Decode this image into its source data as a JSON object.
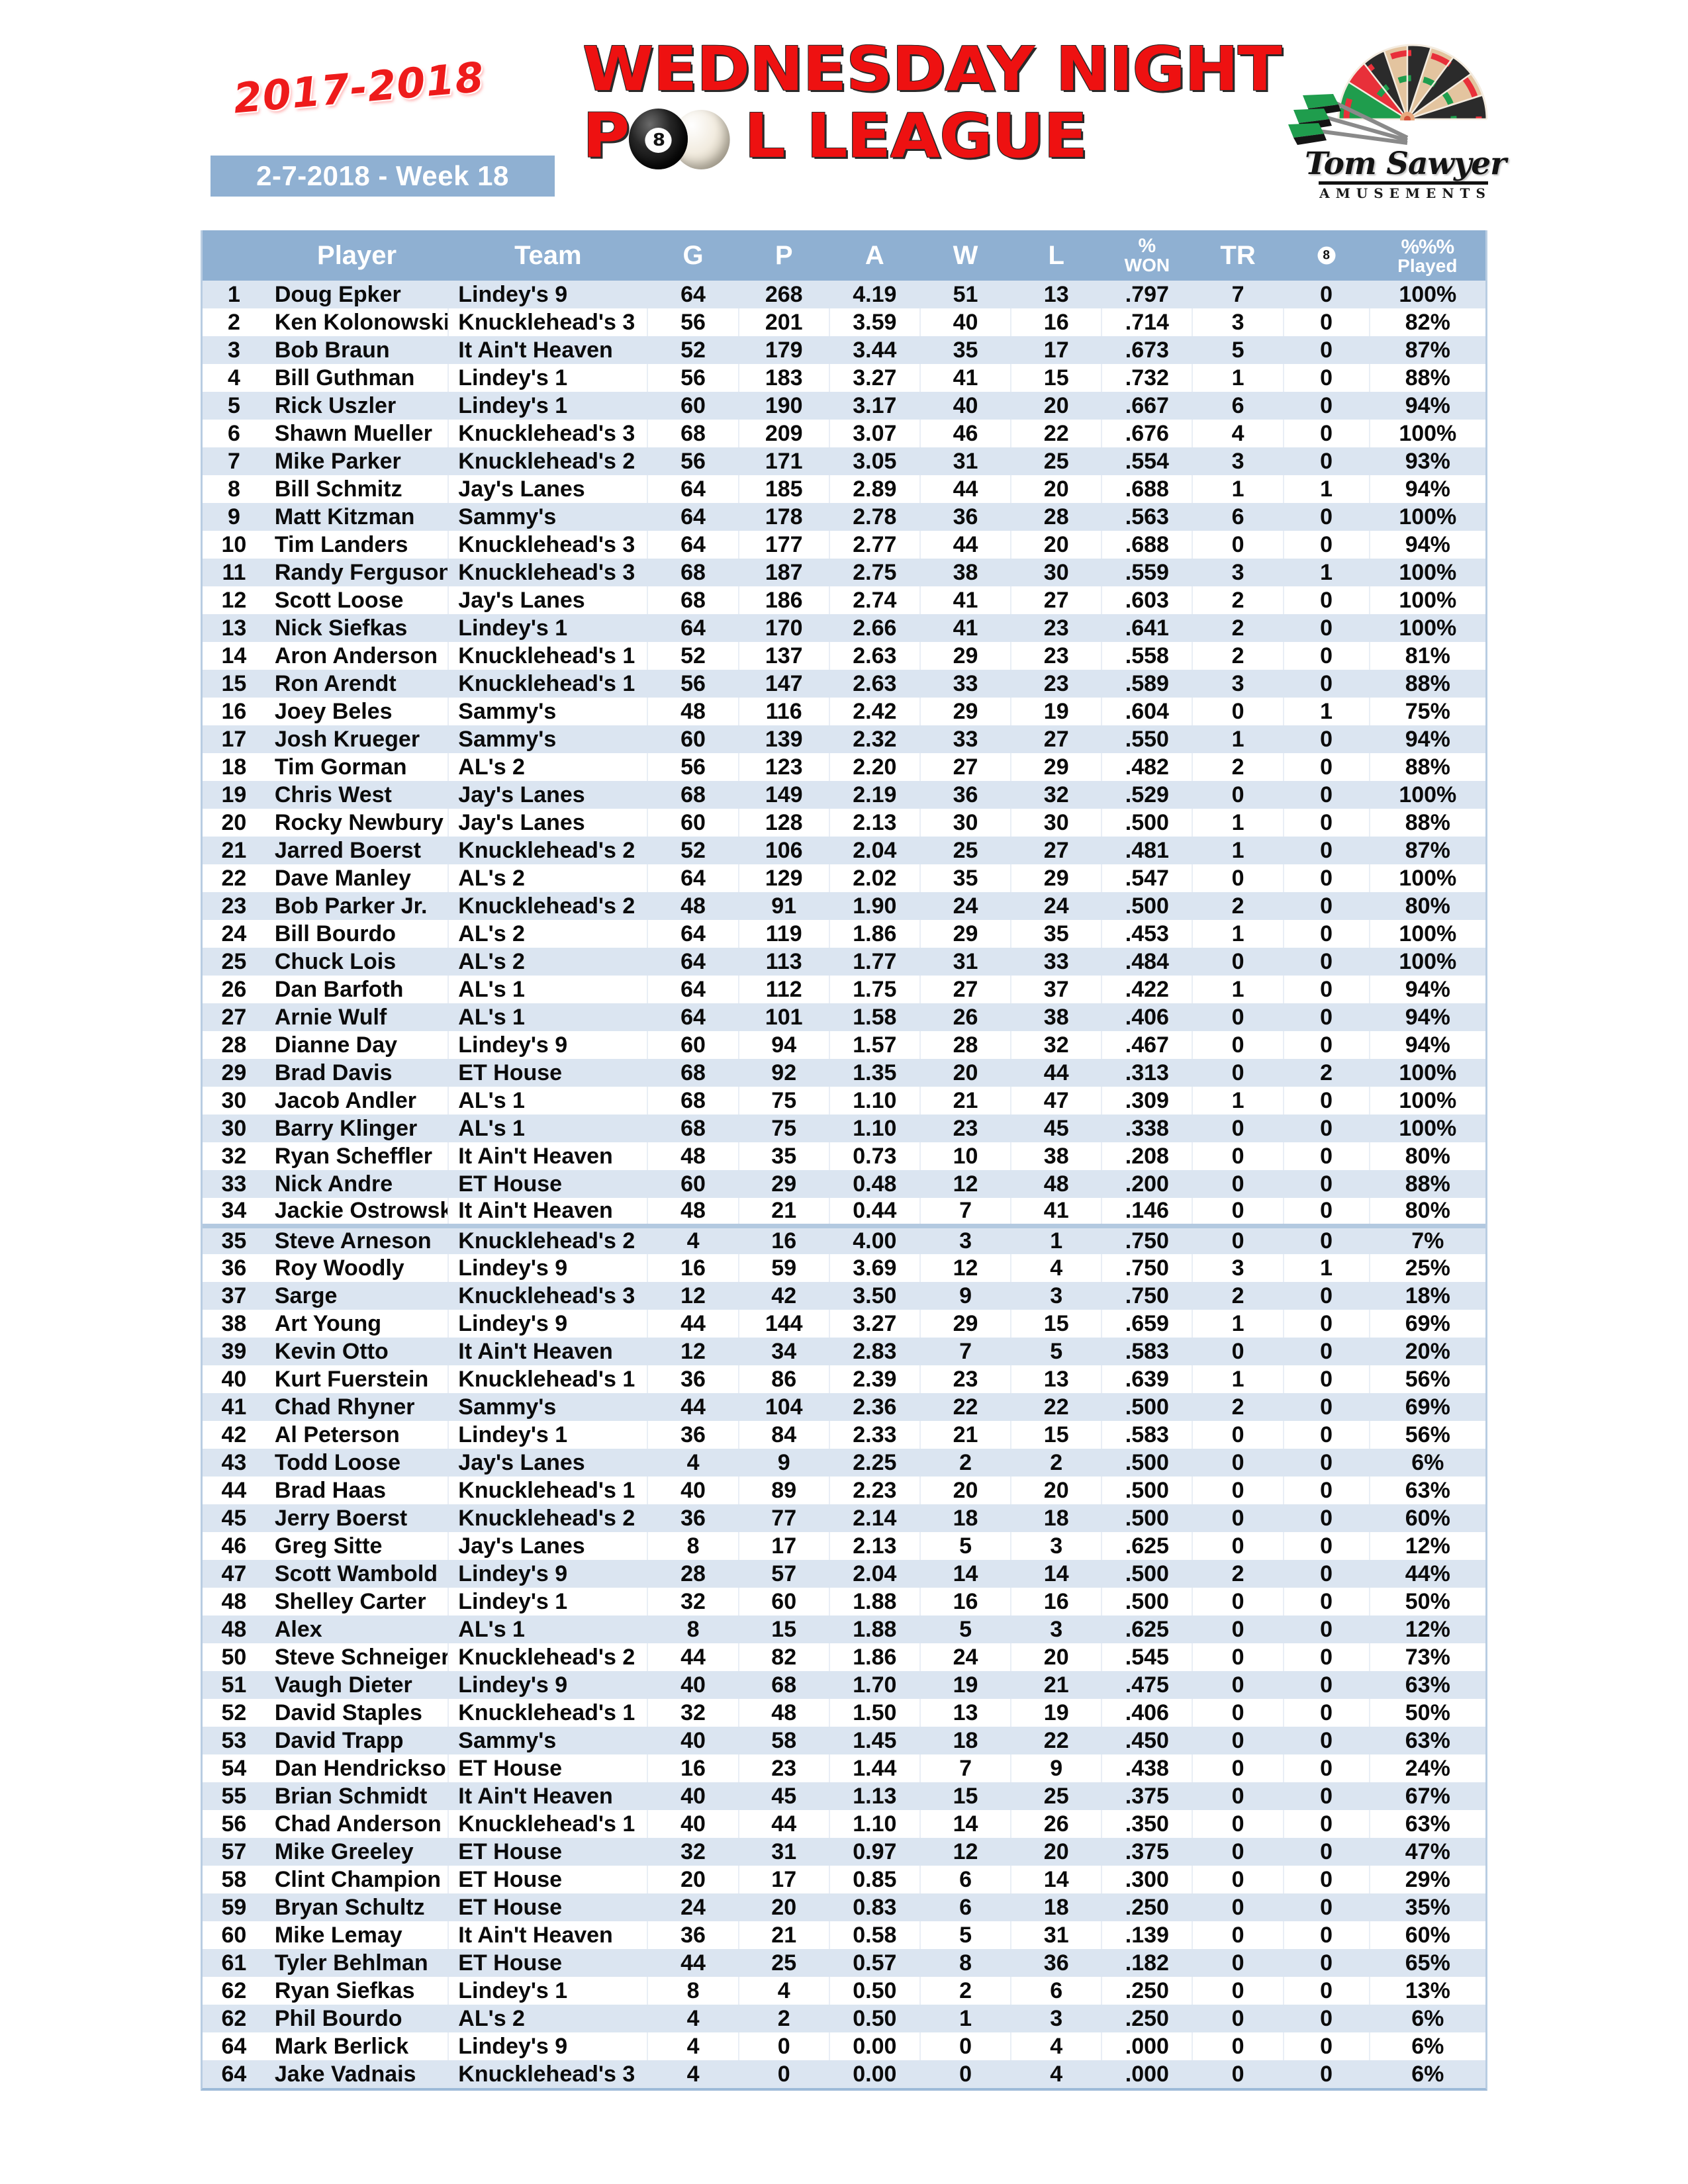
{
  "header": {
    "season": "2017-2018",
    "week_banner": "2-7-2018 - Week 18",
    "title_line1": "WEDNESDAY NIGHT",
    "title_p": "P",
    "title_l_league": "L LEAGUE",
    "logo_name": "Tom Sawyer",
    "logo_sub": "AMUSEMENTS",
    "eight_ball_label": "8"
  },
  "table": {
    "columns": {
      "rank": "",
      "player": "Player",
      "team": "Team",
      "g": "G",
      "p": "P",
      "a": "A",
      "w": "W",
      "l": "L",
      "pct_top": "%",
      "pct_bottom": "WON",
      "tr": "TR",
      "eight": "8",
      "played_top": "%%%",
      "played_bottom": "Played"
    },
    "rows": [
      {
        "rank": "1",
        "player": "Doug Epker",
        "team": "Lindey's 9",
        "g": "64",
        "p": "268",
        "a": "4.19",
        "w": "51",
        "l": "13",
        "pct": ".797",
        "tr": "7",
        "eight": "0",
        "played": "100%"
      },
      {
        "rank": "2",
        "player": "Ken Kolonowski",
        "team": "Knucklehead's 3",
        "g": "56",
        "p": "201",
        "a": "3.59",
        "w": "40",
        "l": "16",
        "pct": ".714",
        "tr": "3",
        "eight": "0",
        "played": "82%"
      },
      {
        "rank": "3",
        "player": "Bob Braun",
        "team": "It Ain't Heaven",
        "g": "52",
        "p": "179",
        "a": "3.44",
        "w": "35",
        "l": "17",
        "pct": ".673",
        "tr": "5",
        "eight": "0",
        "played": "87%"
      },
      {
        "rank": "4",
        "player": "Bill Guthman",
        "team": "Lindey's 1",
        "g": "56",
        "p": "183",
        "a": "3.27",
        "w": "41",
        "l": "15",
        "pct": ".732",
        "tr": "1",
        "eight": "0",
        "played": "88%"
      },
      {
        "rank": "5",
        "player": "Rick Uszler",
        "team": "Lindey's 1",
        "g": "60",
        "p": "190",
        "a": "3.17",
        "w": "40",
        "l": "20",
        "pct": ".667",
        "tr": "6",
        "eight": "0",
        "played": "94%"
      },
      {
        "rank": "6",
        "player": "Shawn Mueller",
        "team": "Knucklehead's 3",
        "g": "68",
        "p": "209",
        "a": "3.07",
        "w": "46",
        "l": "22",
        "pct": ".676",
        "tr": "4",
        "eight": "0",
        "played": "100%"
      },
      {
        "rank": "7",
        "player": "Mike Parker",
        "team": "Knucklehead's 2",
        "g": "56",
        "p": "171",
        "a": "3.05",
        "w": "31",
        "l": "25",
        "pct": ".554",
        "tr": "3",
        "eight": "0",
        "played": "93%"
      },
      {
        "rank": "8",
        "player": "Bill Schmitz",
        "team": "Jay's Lanes",
        "g": "64",
        "p": "185",
        "a": "2.89",
        "w": "44",
        "l": "20",
        "pct": ".688",
        "tr": "1",
        "eight": "1",
        "played": "94%"
      },
      {
        "rank": "9",
        "player": "Matt Kitzman",
        "team": "Sammy's",
        "g": "64",
        "p": "178",
        "a": "2.78",
        "w": "36",
        "l": "28",
        "pct": ".563",
        "tr": "6",
        "eight": "0",
        "played": "100%"
      },
      {
        "rank": "10",
        "player": "Tim Landers",
        "team": "Knucklehead's 3",
        "g": "64",
        "p": "177",
        "a": "2.77",
        "w": "44",
        "l": "20",
        "pct": ".688",
        "tr": "0",
        "eight": "0",
        "played": "94%"
      },
      {
        "rank": "11",
        "player": "Randy Ferguson",
        "team": "Knucklehead's 3",
        "g": "68",
        "p": "187",
        "a": "2.75",
        "w": "38",
        "l": "30",
        "pct": ".559",
        "tr": "3",
        "eight": "1",
        "played": "100%"
      },
      {
        "rank": "12",
        "player": "Scott Loose",
        "team": "Jay's Lanes",
        "g": "68",
        "p": "186",
        "a": "2.74",
        "w": "41",
        "l": "27",
        "pct": ".603",
        "tr": "2",
        "eight": "0",
        "played": "100%"
      },
      {
        "rank": "13",
        "player": "Nick Siefkas",
        "team": "Lindey's 1",
        "g": "64",
        "p": "170",
        "a": "2.66",
        "w": "41",
        "l": "23",
        "pct": ".641",
        "tr": "2",
        "eight": "0",
        "played": "100%"
      },
      {
        "rank": "14",
        "player": "Aron Anderson",
        "team": "Knucklehead's 1",
        "g": "52",
        "p": "137",
        "a": "2.63",
        "w": "29",
        "l": "23",
        "pct": ".558",
        "tr": "2",
        "eight": "0",
        "played": "81%"
      },
      {
        "rank": "15",
        "player": "Ron Arendt",
        "team": "Knucklehead's 1",
        "g": "56",
        "p": "147",
        "a": "2.63",
        "w": "33",
        "l": "23",
        "pct": ".589",
        "tr": "3",
        "eight": "0",
        "played": "88%"
      },
      {
        "rank": "16",
        "player": "Joey Beles",
        "team": "Sammy's",
        "g": "48",
        "p": "116",
        "a": "2.42",
        "w": "29",
        "l": "19",
        "pct": ".604",
        "tr": "0",
        "eight": "1",
        "played": "75%"
      },
      {
        "rank": "17",
        "player": "Josh Krueger",
        "team": "Sammy's",
        "g": "60",
        "p": "139",
        "a": "2.32",
        "w": "33",
        "l": "27",
        "pct": ".550",
        "tr": "1",
        "eight": "0",
        "played": "94%"
      },
      {
        "rank": "18",
        "player": "Tim Gorman",
        "team": "AL's 2",
        "g": "56",
        "p": "123",
        "a": "2.20",
        "w": "27",
        "l": "29",
        "pct": ".482",
        "tr": "2",
        "eight": "0",
        "played": "88%"
      },
      {
        "rank": "19",
        "player": "Chris West",
        "team": "Jay's Lanes",
        "g": "68",
        "p": "149",
        "a": "2.19",
        "w": "36",
        "l": "32",
        "pct": ".529",
        "tr": "0",
        "eight": "0",
        "played": "100%"
      },
      {
        "rank": "20",
        "player": "Rocky Newbury",
        "team": "Jay's Lanes",
        "g": "60",
        "p": "128",
        "a": "2.13",
        "w": "30",
        "l": "30",
        "pct": ".500",
        "tr": "1",
        "eight": "0",
        "played": "88%"
      },
      {
        "rank": "21",
        "player": "Jarred Boerst",
        "team": "Knucklehead's 2",
        "g": "52",
        "p": "106",
        "a": "2.04",
        "w": "25",
        "l": "27",
        "pct": ".481",
        "tr": "1",
        "eight": "0",
        "played": "87%"
      },
      {
        "rank": "22",
        "player": "Dave Manley",
        "team": "AL's 2",
        "g": "64",
        "p": "129",
        "a": "2.02",
        "w": "35",
        "l": "29",
        "pct": ".547",
        "tr": "0",
        "eight": "0",
        "played": "100%"
      },
      {
        "rank": "23",
        "player": "Bob Parker Jr.",
        "team": "Knucklehead's 2",
        "g": "48",
        "p": "91",
        "a": "1.90",
        "w": "24",
        "l": "24",
        "pct": ".500",
        "tr": "2",
        "eight": "0",
        "played": "80%"
      },
      {
        "rank": "24",
        "player": "Bill Bourdo",
        "team": "AL's 2",
        "g": "64",
        "p": "119",
        "a": "1.86",
        "w": "29",
        "l": "35",
        "pct": ".453",
        "tr": "1",
        "eight": "0",
        "played": "100%"
      },
      {
        "rank": "25",
        "player": "Chuck Lois",
        "team": "AL's 2",
        "g": "64",
        "p": "113",
        "a": "1.77",
        "w": "31",
        "l": "33",
        "pct": ".484",
        "tr": "0",
        "eight": "0",
        "played": "100%"
      },
      {
        "rank": "26",
        "player": "Dan Barfoth",
        "team": "AL's 1",
        "g": "64",
        "p": "112",
        "a": "1.75",
        "w": "27",
        "l": "37",
        "pct": ".422",
        "tr": "1",
        "eight": "0",
        "played": "94%"
      },
      {
        "rank": "27",
        "player": "Arnie Wulf",
        "team": "AL's 1",
        "g": "64",
        "p": "101",
        "a": "1.58",
        "w": "26",
        "l": "38",
        "pct": ".406",
        "tr": "0",
        "eight": "0",
        "played": "94%"
      },
      {
        "rank": "28",
        "player": "Dianne Day",
        "team": "Lindey's 9",
        "g": "60",
        "p": "94",
        "a": "1.57",
        "w": "28",
        "l": "32",
        "pct": ".467",
        "tr": "0",
        "eight": "0",
        "played": "94%"
      },
      {
        "rank": "29",
        "player": "Brad Davis",
        "team": "ET House",
        "g": "68",
        "p": "92",
        "a": "1.35",
        "w": "20",
        "l": "44",
        "pct": ".313",
        "tr": "0",
        "eight": "2",
        "played": "100%"
      },
      {
        "rank": "30",
        "player": "Jacob Andler",
        "team": "AL's 1",
        "g": "68",
        "p": "75",
        "a": "1.10",
        "w": "21",
        "l": "47",
        "pct": ".309",
        "tr": "1",
        "eight": "0",
        "played": "100%"
      },
      {
        "rank": "30",
        "player": "Barry Klinger",
        "team": "AL's 1",
        "g": "68",
        "p": "75",
        "a": "1.10",
        "w": "23",
        "l": "45",
        "pct": ".338",
        "tr": "0",
        "eight": "0",
        "played": "100%"
      },
      {
        "rank": "32",
        "player": "Ryan Scheffler",
        "team": "It Ain't Heaven",
        "g": "48",
        "p": "35",
        "a": "0.73",
        "w": "10",
        "l": "38",
        "pct": ".208",
        "tr": "0",
        "eight": "0",
        "played": "80%"
      },
      {
        "rank": "33",
        "player": "Nick Andre",
        "team": "ET House",
        "g": "60",
        "p": "29",
        "a": "0.48",
        "w": "12",
        "l": "48",
        "pct": ".200",
        "tr": "0",
        "eight": "0",
        "played": "88%"
      },
      {
        "rank": "34",
        "player": "Jackie Ostrowski",
        "team": "It Ain't Heaven",
        "g": "48",
        "p": "21",
        "a": "0.44",
        "w": "7",
        "l": "41",
        "pct": ".146",
        "tr": "0",
        "eight": "0",
        "played": "80%"
      },
      {
        "rank": "35",
        "player": "Steve Arneson",
        "team": "Knucklehead's 2",
        "g": "4",
        "p": "16",
        "a": "4.00",
        "w": "3",
        "l": "1",
        "pct": ".750",
        "tr": "0",
        "eight": "0",
        "played": "7%"
      },
      {
        "rank": "36",
        "player": "Roy Woodly",
        "team": "Lindey's 9",
        "g": "16",
        "p": "59",
        "a": "3.69",
        "w": "12",
        "l": "4",
        "pct": ".750",
        "tr": "3",
        "eight": "1",
        "played": "25%"
      },
      {
        "rank": "37",
        "player": "Sarge",
        "team": "Knucklehead's 3",
        "g": "12",
        "p": "42",
        "a": "3.50",
        "w": "9",
        "l": "3",
        "pct": ".750",
        "tr": "2",
        "eight": "0",
        "played": "18%"
      },
      {
        "rank": "38",
        "player": "Art Young",
        "team": "Lindey's 9",
        "g": "44",
        "p": "144",
        "a": "3.27",
        "w": "29",
        "l": "15",
        "pct": ".659",
        "tr": "1",
        "eight": "0",
        "played": "69%"
      },
      {
        "rank": "39",
        "player": "Kevin Otto",
        "team": "It Ain't Heaven",
        "g": "12",
        "p": "34",
        "a": "2.83",
        "w": "7",
        "l": "5",
        "pct": ".583",
        "tr": "0",
        "eight": "0",
        "played": "20%"
      },
      {
        "rank": "40",
        "player": "Kurt Fuerstein",
        "team": "Knucklehead's 1",
        "g": "36",
        "p": "86",
        "a": "2.39",
        "w": "23",
        "l": "13",
        "pct": ".639",
        "tr": "1",
        "eight": "0",
        "played": "56%"
      },
      {
        "rank": "41",
        "player": "Chad Rhyner",
        "team": "Sammy's",
        "g": "44",
        "p": "104",
        "a": "2.36",
        "w": "22",
        "l": "22",
        "pct": ".500",
        "tr": "2",
        "eight": "0",
        "played": "69%"
      },
      {
        "rank": "42",
        "player": "Al Peterson",
        "team": "Lindey's 1",
        "g": "36",
        "p": "84",
        "a": "2.33",
        "w": "21",
        "l": "15",
        "pct": ".583",
        "tr": "0",
        "eight": "0",
        "played": "56%"
      },
      {
        "rank": "43",
        "player": "Todd Loose",
        "team": "Jay's Lanes",
        "g": "4",
        "p": "9",
        "a": "2.25",
        "w": "2",
        "l": "2",
        "pct": ".500",
        "tr": "0",
        "eight": "0",
        "played": "6%"
      },
      {
        "rank": "44",
        "player": "Brad Haas",
        "team": "Knucklehead's 1",
        "g": "40",
        "p": "89",
        "a": "2.23",
        "w": "20",
        "l": "20",
        "pct": ".500",
        "tr": "0",
        "eight": "0",
        "played": "63%"
      },
      {
        "rank": "45",
        "player": "Jerry Boerst",
        "team": "Knucklehead's 2",
        "g": "36",
        "p": "77",
        "a": "2.14",
        "w": "18",
        "l": "18",
        "pct": ".500",
        "tr": "0",
        "eight": "0",
        "played": "60%"
      },
      {
        "rank": "46",
        "player": "Greg Sitte",
        "team": "Jay's Lanes",
        "g": "8",
        "p": "17",
        "a": "2.13",
        "w": "5",
        "l": "3",
        "pct": ".625",
        "tr": "0",
        "eight": "0",
        "played": "12%"
      },
      {
        "rank": "47",
        "player": "Scott Wambold",
        "team": "Lindey's 9",
        "g": "28",
        "p": "57",
        "a": "2.04",
        "w": "14",
        "l": "14",
        "pct": ".500",
        "tr": "2",
        "eight": "0",
        "played": "44%"
      },
      {
        "rank": "48",
        "player": "Shelley Carter",
        "team": "Lindey's 1",
        "g": "32",
        "p": "60",
        "a": "1.88",
        "w": "16",
        "l": "16",
        "pct": ".500",
        "tr": "0",
        "eight": "0",
        "played": "50%"
      },
      {
        "rank": "48",
        "player": "Alex",
        "team": "AL's 1",
        "g": "8",
        "p": "15",
        "a": "1.88",
        "w": "5",
        "l": "3",
        "pct": ".625",
        "tr": "0",
        "eight": "0",
        "played": "12%"
      },
      {
        "rank": "50",
        "player": "Steve Schneiger",
        "team": "Knucklehead's 2",
        "g": "44",
        "p": "82",
        "a": "1.86",
        "w": "24",
        "l": "20",
        "pct": ".545",
        "tr": "0",
        "eight": "0",
        "played": "73%"
      },
      {
        "rank": "51",
        "player": "Vaugh Dieter",
        "team": "Lindey's 9",
        "g": "40",
        "p": "68",
        "a": "1.70",
        "w": "19",
        "l": "21",
        "pct": ".475",
        "tr": "0",
        "eight": "0",
        "played": "63%"
      },
      {
        "rank": "52",
        "player": "David Staples",
        "team": "Knucklehead's 1",
        "g": "32",
        "p": "48",
        "a": "1.50",
        "w": "13",
        "l": "19",
        "pct": ".406",
        "tr": "0",
        "eight": "0",
        "played": "50%"
      },
      {
        "rank": "53",
        "player": "David Trapp",
        "team": "Sammy's",
        "g": "40",
        "p": "58",
        "a": "1.45",
        "w": "18",
        "l": "22",
        "pct": ".450",
        "tr": "0",
        "eight": "0",
        "played": "63%"
      },
      {
        "rank": "54",
        "player": "Dan Hendrickson",
        "team": "ET House",
        "g": "16",
        "p": "23",
        "a": "1.44",
        "w": "7",
        "l": "9",
        "pct": ".438",
        "tr": "0",
        "eight": "0",
        "played": "24%"
      },
      {
        "rank": "55",
        "player": "Brian Schmidt",
        "team": "It Ain't Heaven",
        "g": "40",
        "p": "45",
        "a": "1.13",
        "w": "15",
        "l": "25",
        "pct": ".375",
        "tr": "0",
        "eight": "0",
        "played": "67%"
      },
      {
        "rank": "56",
        "player": "Chad Anderson",
        "team": "Knucklehead's 1",
        "g": "40",
        "p": "44",
        "a": "1.10",
        "w": "14",
        "l": "26",
        "pct": ".350",
        "tr": "0",
        "eight": "0",
        "played": "63%"
      },
      {
        "rank": "57",
        "player": "Mike Greeley",
        "team": "ET House",
        "g": "32",
        "p": "31",
        "a": "0.97",
        "w": "12",
        "l": "20",
        "pct": ".375",
        "tr": "0",
        "eight": "0",
        "played": "47%"
      },
      {
        "rank": "58",
        "player": "Clint Champion",
        "team": "ET House",
        "g": "20",
        "p": "17",
        "a": "0.85",
        "w": "6",
        "l": "14",
        "pct": ".300",
        "tr": "0",
        "eight": "0",
        "played": "29%"
      },
      {
        "rank": "59",
        "player": "Bryan Schultz",
        "team": "ET House",
        "g": "24",
        "p": "20",
        "a": "0.83",
        "w": "6",
        "l": "18",
        "pct": ".250",
        "tr": "0",
        "eight": "0",
        "played": "35%"
      },
      {
        "rank": "60",
        "player": "Mike Lemay",
        "team": "It Ain't Heaven",
        "g": "36",
        "p": "21",
        "a": "0.58",
        "w": "5",
        "l": "31",
        "pct": ".139",
        "tr": "0",
        "eight": "0",
        "played": "60%"
      },
      {
        "rank": "61",
        "player": "Tyler Behlman",
        "team": "ET House",
        "g": "44",
        "p": "25",
        "a": "0.57",
        "w": "8",
        "l": "36",
        "pct": ".182",
        "tr": "0",
        "eight": "0",
        "played": "65%"
      },
      {
        "rank": "62",
        "player": "Ryan Siefkas",
        "team": "Lindey's 1",
        "g": "8",
        "p": "4",
        "a": "0.50",
        "w": "2",
        "l": "6",
        "pct": ".250",
        "tr": "0",
        "eight": "0",
        "played": "13%"
      },
      {
        "rank": "62",
        "player": "Phil Bourdo",
        "team": "AL's 2",
        "g": "4",
        "p": "2",
        "a": "0.50",
        "w": "1",
        "l": "3",
        "pct": ".250",
        "tr": "0",
        "eight": "0",
        "played": "6%"
      },
      {
        "rank": "64",
        "player": "Mark Berlick",
        "team": "Lindey's 9",
        "g": "4",
        "p": "0",
        "a": "0.00",
        "w": "0",
        "l": "4",
        "pct": ".000",
        "tr": "0",
        "eight": "0",
        "played": "6%"
      },
      {
        "rank": "64",
        "player": "Jake Vadnais",
        "team": "Knucklehead's 3",
        "g": "4",
        "p": "0",
        "a": "0.00",
        "w": "0",
        "l": "4",
        "pct": ".000",
        "tr": "0",
        "eight": "0",
        "played": "6%"
      }
    ],
    "section_break_after_index": 33
  }
}
